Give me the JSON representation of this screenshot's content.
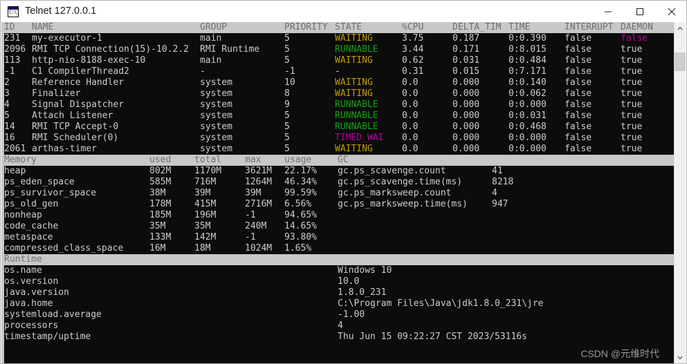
{
  "window": {
    "title": "Telnet 127.0.0.1",
    "icon": "console-icon",
    "controls": {
      "minimize": "minimize-icon",
      "maximize": "maximize-icon",
      "close": "close-icon"
    }
  },
  "colors": {
    "terminal_bg": "#0c0c0c",
    "terminal_fg": "#cccccc",
    "header_bg": "#c8c8c8",
    "header_fg": "#6f6f6f",
    "state_waiting": "#c19c00",
    "state_runnable": "#13a10e",
    "state_timed_waiting": "#b4009e",
    "daemon_highlight": "#b4009e"
  },
  "threads": {
    "headers": [
      "ID",
      "NAME",
      "GROUP",
      "PRIORITY",
      "STATE",
      "%CPU",
      "DELTA_TIM",
      "TIME",
      "INTERRUPT",
      "DAEMON"
    ],
    "rows": [
      {
        "id": "231",
        "name": "my-executor-1",
        "group": "main",
        "priority": "5",
        "state": "WAITING",
        "state_kind": "waiting",
        "cpu": "3.75",
        "delta_time": "0.187",
        "time": "0:0.390",
        "interrupt": "false",
        "daemon": "false",
        "daemon_kind": "highlight"
      },
      {
        "id": "2096",
        "name": "RMI TCP Connection(15)-10.2.2",
        "group": "RMI Runtime",
        "priority": "5",
        "state": "RUNNABLE",
        "state_kind": "runnable",
        "cpu": "3.44",
        "delta_time": "0.171",
        "time": "0:8.015",
        "interrupt": "false",
        "daemon": "true",
        "daemon_kind": "normal"
      },
      {
        "id": "113",
        "name": "http-nio-8188-exec-10",
        "group": "main",
        "priority": "5",
        "state": "WAITING",
        "state_kind": "waiting",
        "cpu": "0.62",
        "delta_time": "0.031",
        "time": "0:0.484",
        "interrupt": "false",
        "daemon": "true",
        "daemon_kind": "normal"
      },
      {
        "id": "-1",
        "name": "C1 CompilerThread2",
        "group": "-",
        "priority": "-1",
        "state": "-",
        "state_kind": "dash",
        "cpu": "0.31",
        "delta_time": "0.015",
        "time": "0:7.171",
        "interrupt": "false",
        "daemon": "true",
        "daemon_kind": "normal"
      },
      {
        "id": "2",
        "name": "Reference Handler",
        "group": "system",
        "priority": "10",
        "state": "WAITING",
        "state_kind": "waiting",
        "cpu": "0.0",
        "delta_time": "0.000",
        "time": "0:0.140",
        "interrupt": "false",
        "daemon": "true",
        "daemon_kind": "normal"
      },
      {
        "id": "3",
        "name": "Finalizer",
        "group": "system",
        "priority": "8",
        "state": "WAITING",
        "state_kind": "waiting",
        "cpu": "0.0",
        "delta_time": "0.000",
        "time": "0:0.062",
        "interrupt": "false",
        "daemon": "true",
        "daemon_kind": "normal"
      },
      {
        "id": "4",
        "name": "Signal Dispatcher",
        "group": "system",
        "priority": "9",
        "state": "RUNNABLE",
        "state_kind": "runnable",
        "cpu": "0.0",
        "delta_time": "0.000",
        "time": "0:0.000",
        "interrupt": "false",
        "daemon": "true",
        "daemon_kind": "normal"
      },
      {
        "id": "5",
        "name": "Attach Listener",
        "group": "system",
        "priority": "5",
        "state": "RUNNABLE",
        "state_kind": "runnable",
        "cpu": "0.0",
        "delta_time": "0.000",
        "time": "0:0.031",
        "interrupt": "false",
        "daemon": "true",
        "daemon_kind": "normal"
      },
      {
        "id": "14",
        "name": "RMI TCP Accept-0",
        "group": "system",
        "priority": "5",
        "state": "RUNNABLE",
        "state_kind": "runnable",
        "cpu": "0.0",
        "delta_time": "0.000",
        "time": "0:0.468",
        "interrupt": "false",
        "daemon": "true",
        "daemon_kind": "normal"
      },
      {
        "id": "16",
        "name": "RMI Scheduler(0)",
        "group": "system",
        "priority": "5",
        "state": "TIMED_WAI",
        "state_kind": "timed",
        "cpu": "0.0",
        "delta_time": "0.000",
        "time": "0:0.000",
        "interrupt": "false",
        "daemon": "true",
        "daemon_kind": "normal"
      },
      {
        "id": "2061",
        "name": "arthas-timer",
        "group": "system",
        "priority": "5",
        "state": "WAITING",
        "state_kind": "waiting",
        "cpu": "0.0",
        "delta_time": "0.000",
        "time": "0:0.000",
        "interrupt": "false",
        "daemon": "true",
        "daemon_kind": "normal"
      }
    ]
  },
  "memory": {
    "title": "Memory",
    "headers": [
      "used",
      "total",
      "max",
      "usage"
    ],
    "rows": [
      {
        "name": "heap",
        "used": "802M",
        "total": "1170M",
        "max": "3621M",
        "usage": "22.17%"
      },
      {
        "name": "ps_eden_space",
        "used": "585M",
        "total": "716M",
        "max": "1264M",
        "usage": "46.34%"
      },
      {
        "name": "ps_survivor_space",
        "used": "38M",
        "total": "39M",
        "max": "39M",
        "usage": "99.59%"
      },
      {
        "name": "ps_old_gen",
        "used": "178M",
        "total": "415M",
        "max": "2716M",
        "usage": "6.56%"
      },
      {
        "name": "nonheap",
        "used": "185M",
        "total": "196M",
        "max": "-1",
        "usage": "94.65%"
      },
      {
        "name": "code_cache",
        "used": "35M",
        "total": "35M",
        "max": "240M",
        "usage": "14.65%"
      },
      {
        "name": "metaspace",
        "used": "133M",
        "total": "142M",
        "max": "-1",
        "usage": "93.80%"
      },
      {
        "name": "compressed_class_space",
        "used": "16M",
        "total": "18M",
        "max": "1024M",
        "usage": "1.65%"
      }
    ]
  },
  "gc": {
    "title": "GC",
    "rows": [
      {
        "name": "gc.ps_scavenge.count",
        "value": "41"
      },
      {
        "name": "gc.ps_scavenge.time(ms)",
        "value": "8218"
      },
      {
        "name": "gc.ps_marksweep.count",
        "value": "4"
      },
      {
        "name": "gc.ps_marksweep.time(ms)",
        "value": "947"
      }
    ]
  },
  "runtime": {
    "title": "Runtime",
    "rows": [
      {
        "name": "os.name",
        "value": "Windows 10"
      },
      {
        "name": "os.version",
        "value": "10.0"
      },
      {
        "name": "java.version",
        "value": "1.8.0_231"
      },
      {
        "name": "java.home",
        "value": "C:\\Program Files\\Java\\jdk1.8.0_231\\jre"
      },
      {
        "name": "systemload.average",
        "value": "-1.00"
      },
      {
        "name": "processors",
        "value": "4"
      },
      {
        "name": "timestamp/uptime",
        "value": "Thu Jun 15 09:22:27 CST 2023/53116s"
      }
    ]
  },
  "scrollbar": {
    "up_arrow": "chevron-up-icon",
    "down_arrow": "chevron-down-icon"
  },
  "watermark": "CSDN @元维时代"
}
